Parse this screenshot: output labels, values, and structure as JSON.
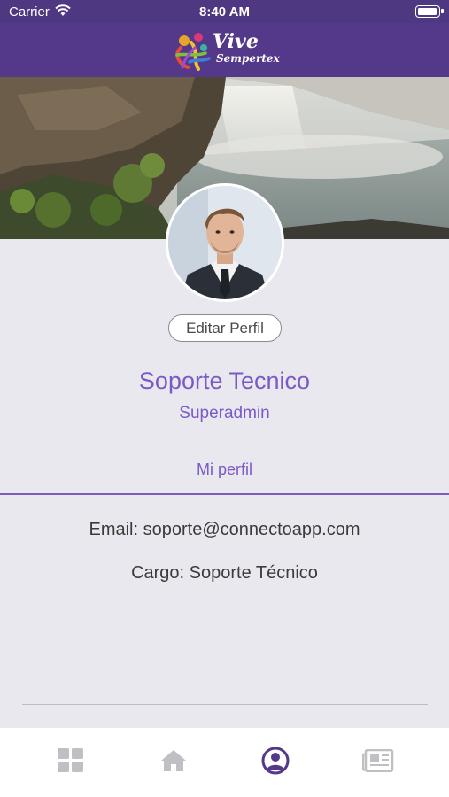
{
  "status_bar": {
    "carrier": "Carrier",
    "time": "8:40 AM",
    "battery_level": 0.9
  },
  "header": {
    "logo_line_1": "Vive",
    "logo_line_2": "Sempertex",
    "color": "#54398a"
  },
  "profile": {
    "edit_label": "Editar Perfil",
    "name": "Soporte Tecnico",
    "role": "Superadmin",
    "section_label": "Mi perfil",
    "email_line": "Email: soporte@connectoapp.com",
    "cargo_line": "Cargo: Soporte Técnico",
    "accent_color": "#7b59c7"
  },
  "tab_bar": {
    "tabs": [
      {
        "icon": "grid-icon",
        "active": false
      },
      {
        "icon": "home-icon",
        "active": false
      },
      {
        "icon": "user-icon",
        "active": true
      },
      {
        "icon": "newspaper-icon",
        "active": false
      }
    ],
    "active_color": "#54398a",
    "inactive_color": "#bfbfc4"
  }
}
